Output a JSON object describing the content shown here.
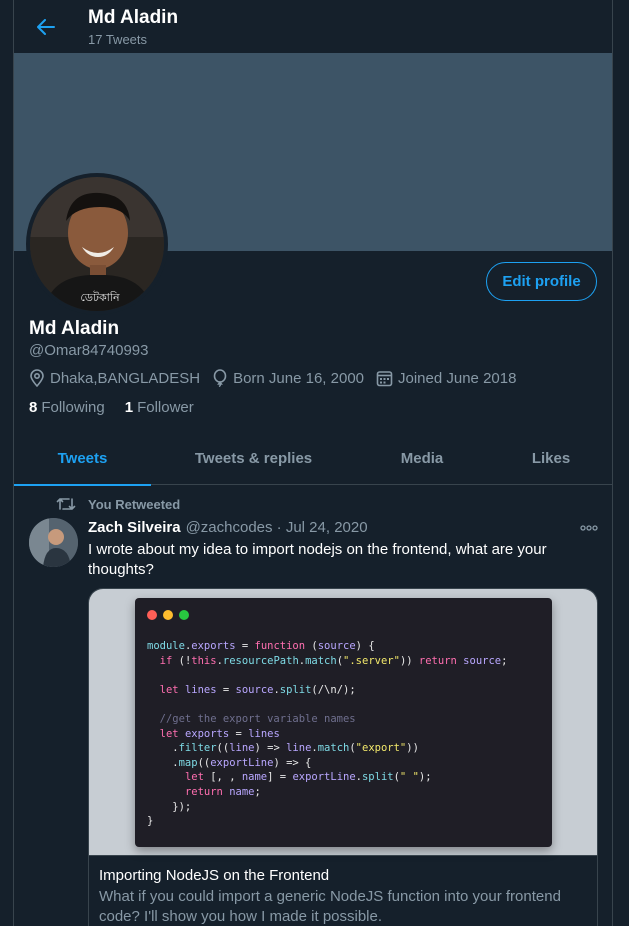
{
  "header": {
    "name": "Md Aladin",
    "tweet_count": "17 Tweets"
  },
  "profile": {
    "name": "Md Aladin",
    "handle": "@Omar84740993",
    "edit_label": "Edit profile",
    "location": "Dhaka,BANGLADESH",
    "born": "Born June 16, 2000",
    "joined": "Joined June 2018",
    "following_count": "8",
    "following_label": "Following",
    "follower_count": "1",
    "follower_label": "Follower"
  },
  "tabs": [
    {
      "label": "Tweets"
    },
    {
      "label": "Tweets & replies"
    },
    {
      "label": "Media"
    },
    {
      "label": "Likes"
    }
  ],
  "tweet": {
    "retweet_note": "You Retweeted",
    "author": "Zach Silveira",
    "handle_date": "@zachcodes · Jul 24, 2020",
    "text": "I wrote about my idea to import nodejs on the frontend, what are your thoughts?",
    "card": {
      "title": "Importing NodeJS on the Frontend",
      "description": "What if you could import a generic NodeJS function into your frontend code? I'll show you how I made it possible.",
      "code_lines": [
        "module.exports = function (source) {",
        "  if (!this.resourcePath.match(\".server\")) return source;",
        "",
        "  let lines = source.split(/\\n/);",
        "",
        "  //get the export variable names",
        "  let exports = lines",
        "    .filter((line) => line.match(\"export\"))",
        "    .map((exportLine) => {",
        "      let [, , name] = exportLine.split(\" \");",
        "      return name;",
        "    });",
        "}"
      ]
    }
  },
  "colors": {
    "accent": "#1da1f2",
    "background": "#15202b",
    "banner": "#3d5466",
    "muted": "#8899a6",
    "border": "#38444d"
  }
}
